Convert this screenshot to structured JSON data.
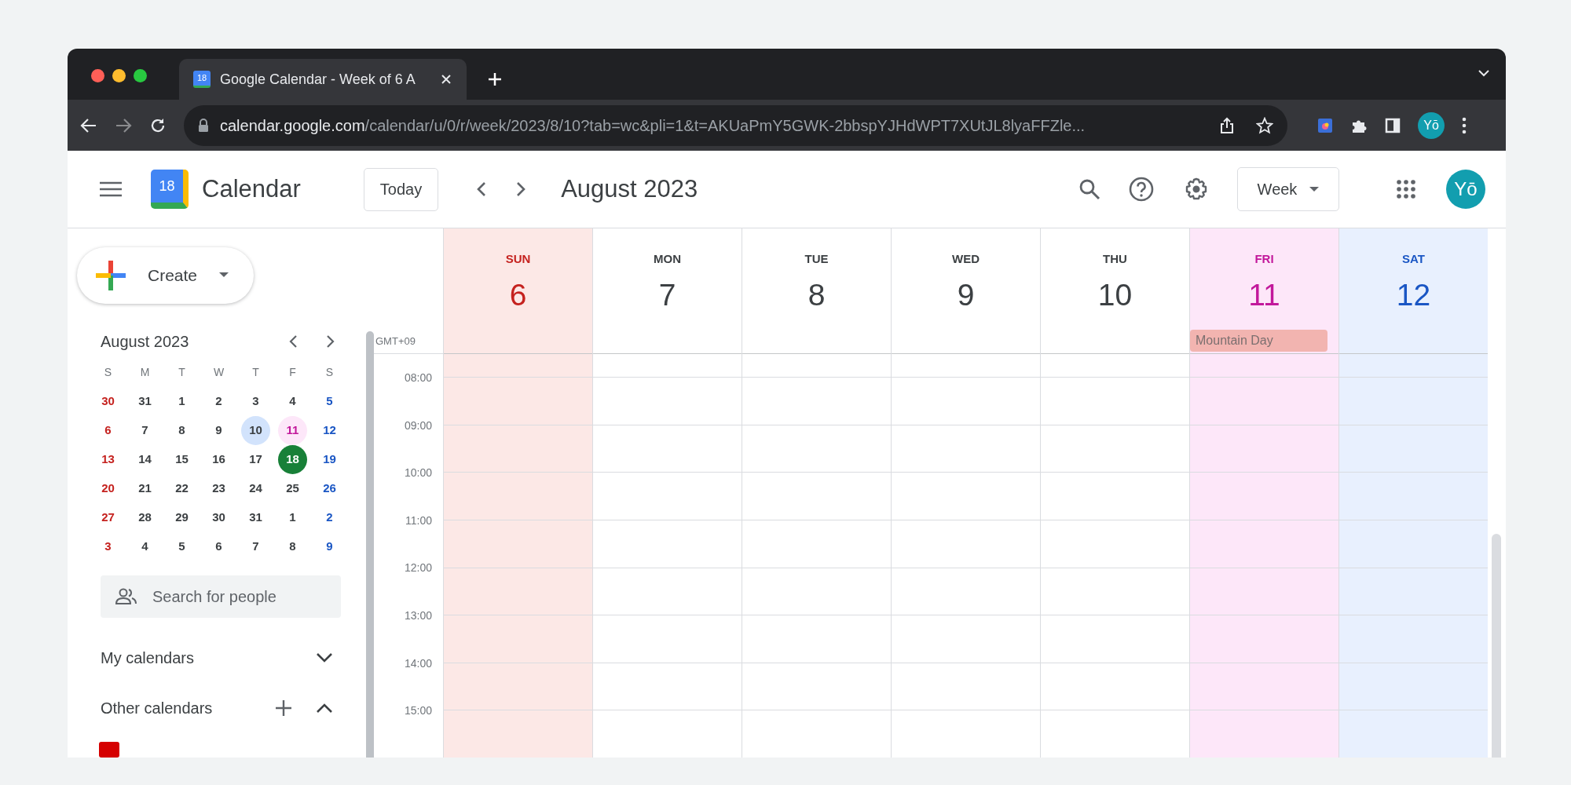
{
  "browser": {
    "tab": {
      "favicon_text": "18",
      "title": "Google Calendar - Week of 6 A"
    },
    "url_host": "calendar.google.com",
    "url_path": "/calendar/u/0/r/week/2023/8/10?tab=wc&pli=1&t=AKUaPmY5GWK-2bbspYJHdWPT7XUtJL8lyaFFZle...",
    "profile": "Yō"
  },
  "header": {
    "logo_text": "18",
    "app_name": "Calendar",
    "today_button": "Today",
    "period": "August 2023",
    "view_button": "Week",
    "avatar": "Yō"
  },
  "sidebar": {
    "create_button": "Create",
    "mini_calendar": {
      "title": "August 2023",
      "weekdays": [
        "S",
        "M",
        "T",
        "W",
        "T",
        "F",
        "S"
      ],
      "days": [
        {
          "n": "30",
          "kind": "sun",
          "selected": false,
          "today": false
        },
        {
          "n": "31",
          "kind": "day",
          "selected": false,
          "today": false
        },
        {
          "n": "1",
          "kind": "day",
          "selected": false,
          "today": false
        },
        {
          "n": "2",
          "kind": "day",
          "selected": false,
          "today": false
        },
        {
          "n": "3",
          "kind": "day",
          "selected": false,
          "today": false
        },
        {
          "n": "4",
          "kind": "day",
          "selected": false,
          "today": false
        },
        {
          "n": "5",
          "kind": "sat",
          "selected": false,
          "today": false
        },
        {
          "n": "6",
          "kind": "sun",
          "selected": false,
          "today": false
        },
        {
          "n": "7",
          "kind": "day",
          "selected": false,
          "today": false
        },
        {
          "n": "8",
          "kind": "day",
          "selected": false,
          "today": false
        },
        {
          "n": "9",
          "kind": "day",
          "selected": false,
          "today": false
        },
        {
          "n": "10",
          "kind": "day",
          "selected": true,
          "today": false
        },
        {
          "n": "11",
          "kind": "holiday",
          "selected": false,
          "today": false
        },
        {
          "n": "12",
          "kind": "sat",
          "selected": false,
          "today": false
        },
        {
          "n": "13",
          "kind": "sun",
          "selected": false,
          "today": false
        },
        {
          "n": "14",
          "kind": "day",
          "selected": false,
          "today": false
        },
        {
          "n": "15",
          "kind": "day",
          "selected": false,
          "today": false
        },
        {
          "n": "16",
          "kind": "day",
          "selected": false,
          "today": false
        },
        {
          "n": "17",
          "kind": "day",
          "selected": false,
          "today": false
        },
        {
          "n": "18",
          "kind": "day",
          "selected": false,
          "today": true
        },
        {
          "n": "19",
          "kind": "sat",
          "selected": false,
          "today": false
        },
        {
          "n": "20",
          "kind": "sun",
          "selected": false,
          "today": false
        },
        {
          "n": "21",
          "kind": "day",
          "selected": false,
          "today": false
        },
        {
          "n": "22",
          "kind": "day",
          "selected": false,
          "today": false
        },
        {
          "n": "23",
          "kind": "day",
          "selected": false,
          "today": false
        },
        {
          "n": "24",
          "kind": "day",
          "selected": false,
          "today": false
        },
        {
          "n": "25",
          "kind": "day",
          "selected": false,
          "today": false
        },
        {
          "n": "26",
          "kind": "sat",
          "selected": false,
          "today": false
        },
        {
          "n": "27",
          "kind": "sun",
          "selected": false,
          "today": false
        },
        {
          "n": "28",
          "kind": "day",
          "selected": false,
          "today": false
        },
        {
          "n": "29",
          "kind": "day",
          "selected": false,
          "today": false
        },
        {
          "n": "30",
          "kind": "day",
          "selected": false,
          "today": false
        },
        {
          "n": "31",
          "kind": "day",
          "selected": false,
          "today": false
        },
        {
          "n": "1",
          "kind": "day",
          "selected": false,
          "today": false
        },
        {
          "n": "2",
          "kind": "sat",
          "selected": false,
          "today": false
        },
        {
          "n": "3",
          "kind": "sun",
          "selected": false,
          "today": false
        },
        {
          "n": "4",
          "kind": "day",
          "selected": false,
          "today": false
        },
        {
          "n": "5",
          "kind": "day",
          "selected": false,
          "today": false
        },
        {
          "n": "6",
          "kind": "day",
          "selected": false,
          "today": false
        },
        {
          "n": "7",
          "kind": "day",
          "selected": false,
          "today": false
        },
        {
          "n": "8",
          "kind": "day",
          "selected": false,
          "today": false
        },
        {
          "n": "9",
          "kind": "sat",
          "selected": false,
          "today": false
        }
      ]
    },
    "search": {
      "placeholder": "Search for people"
    },
    "sections": [
      {
        "label": "My calendars",
        "expanded": false,
        "add": false
      },
      {
        "label": "Other calendars",
        "expanded": true,
        "add": true
      }
    ]
  },
  "week": {
    "timezone": "GMT+09",
    "days": [
      {
        "name": "SUN",
        "date": "6",
        "kind": "sun"
      },
      {
        "name": "MON",
        "date": "7",
        "kind": "day"
      },
      {
        "name": "TUE",
        "date": "8",
        "kind": "day"
      },
      {
        "name": "WED",
        "date": "9",
        "kind": "day"
      },
      {
        "name": "THU",
        "date": "10",
        "kind": "day"
      },
      {
        "name": "FRI",
        "date": "11",
        "kind": "holiday",
        "events": [
          "Mountain Day"
        ]
      },
      {
        "name": "SAT",
        "date": "12",
        "kind": "sat"
      }
    ],
    "hours": [
      "08:00",
      "09:00",
      "10:00",
      "11:00",
      "12:00",
      "13:00",
      "14:00",
      "15:00"
    ]
  }
}
